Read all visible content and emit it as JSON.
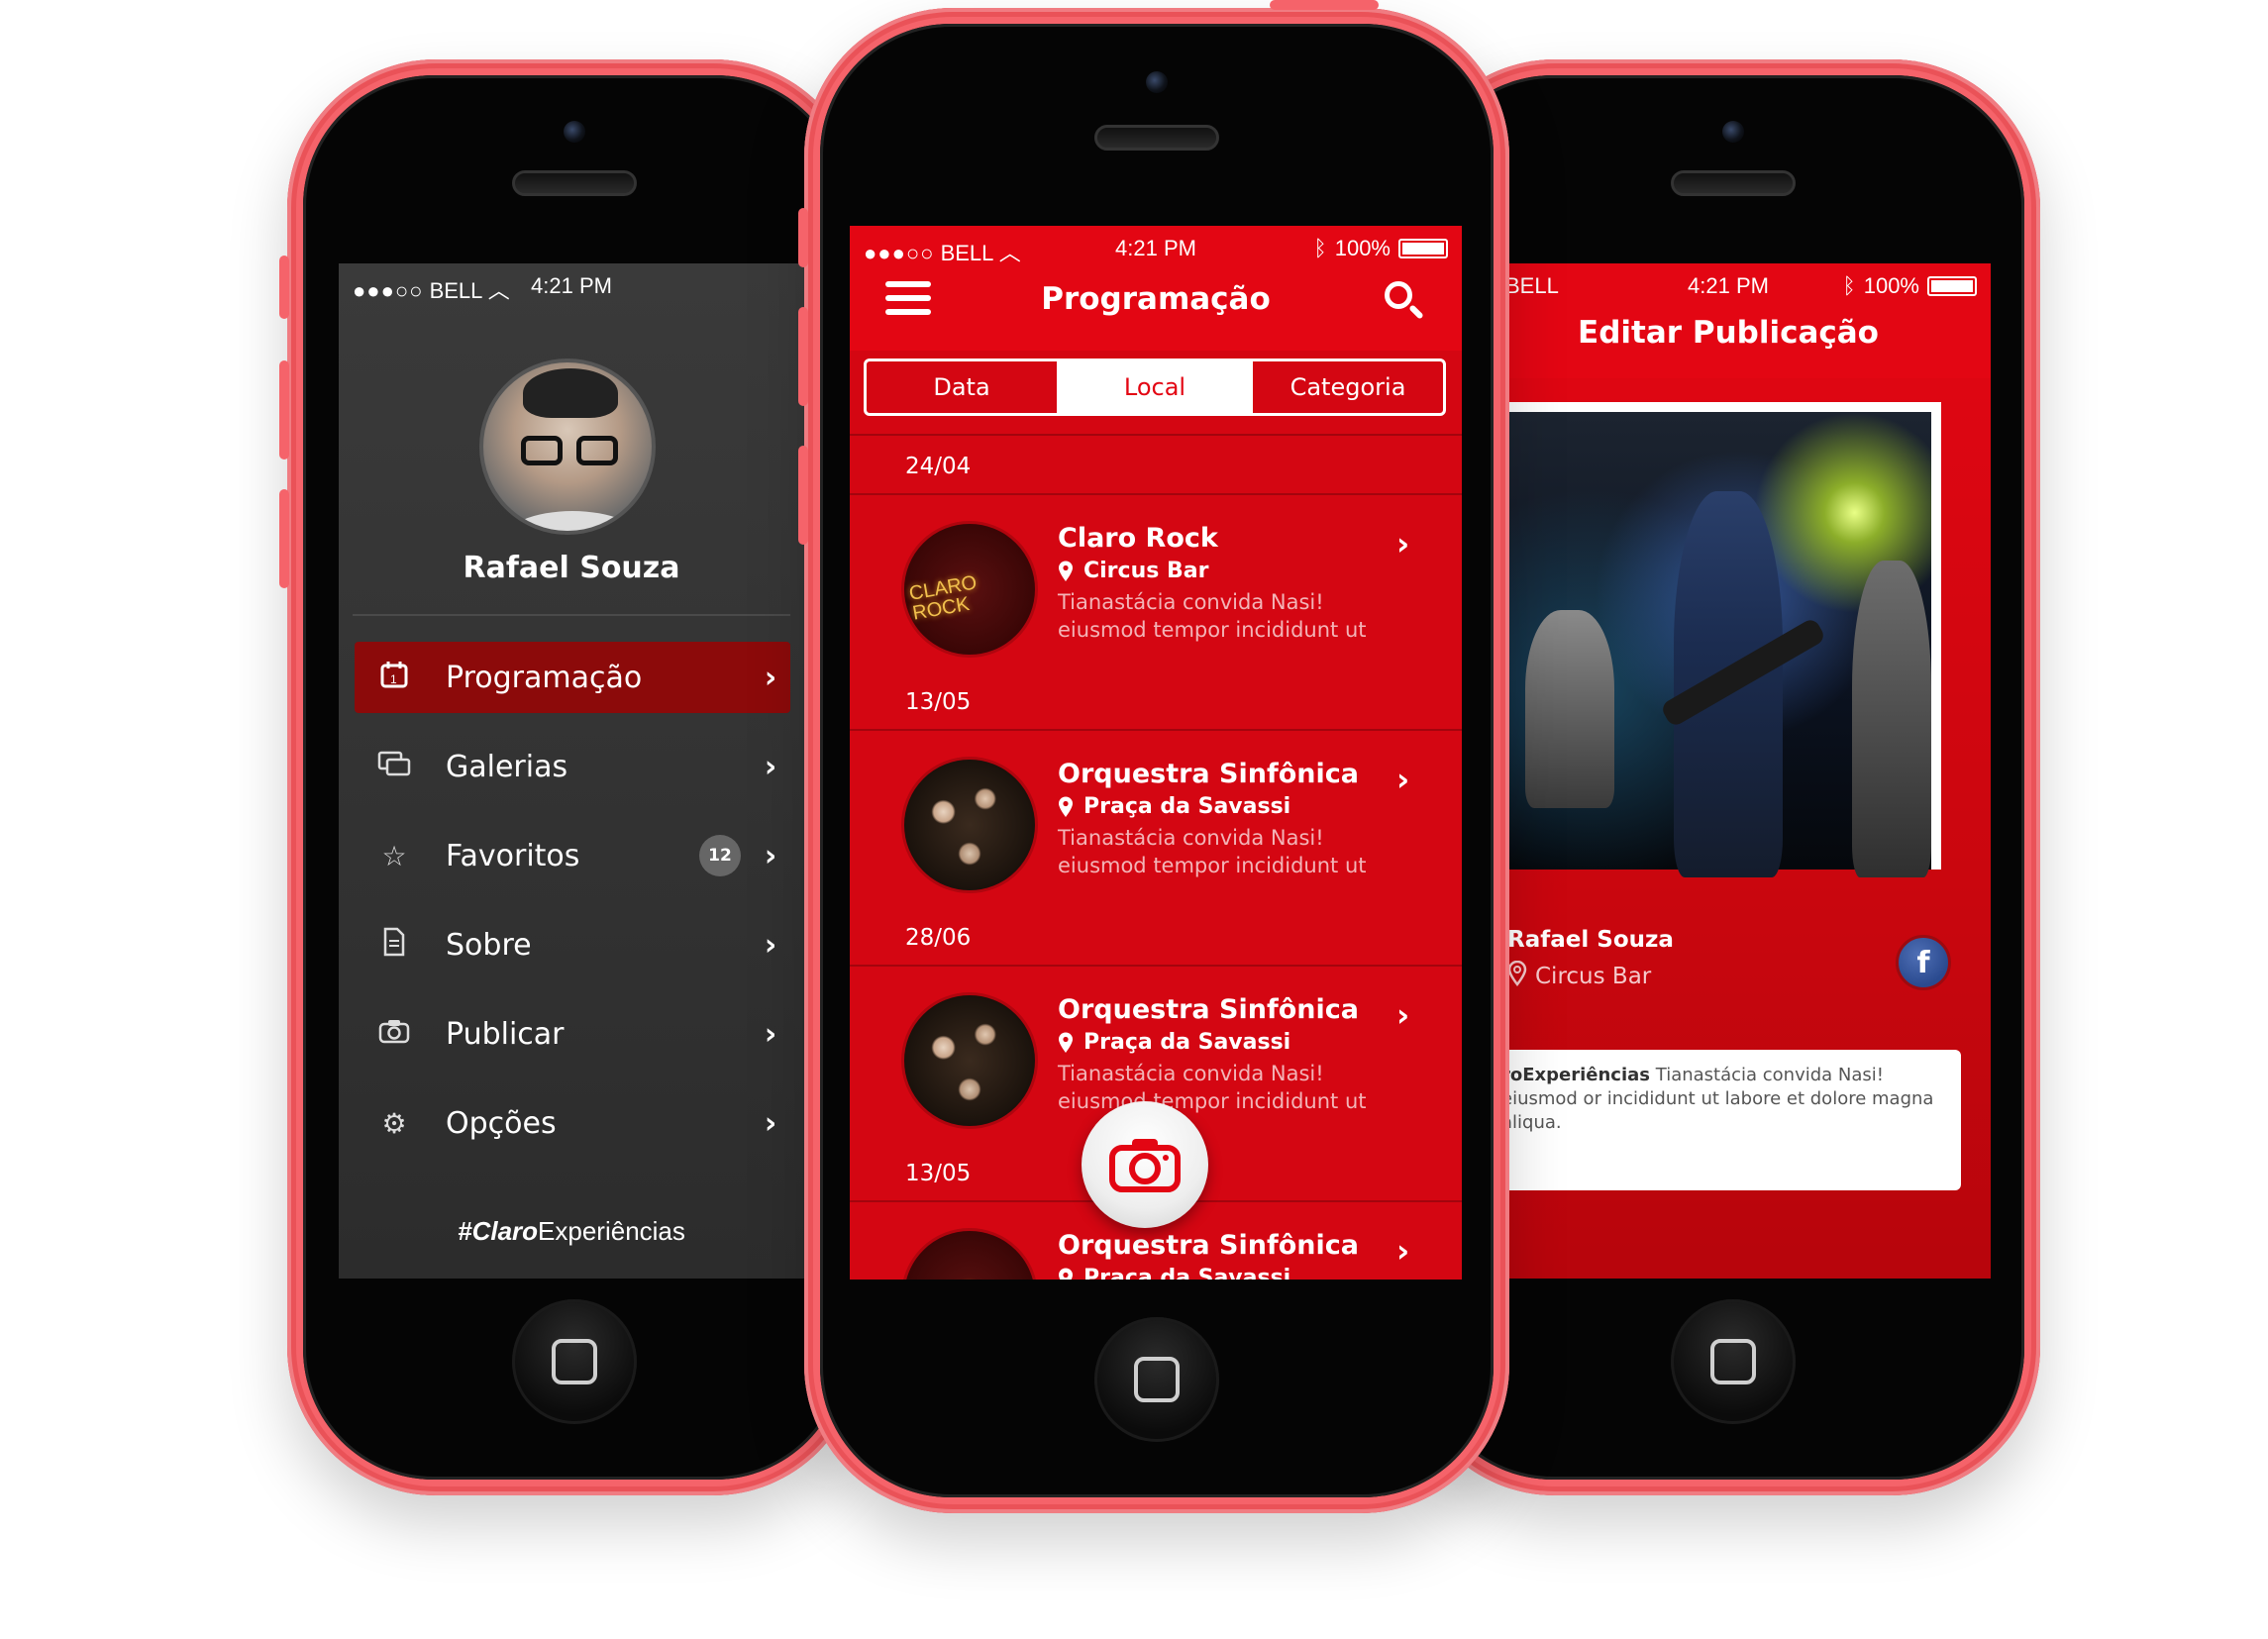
{
  "colors": {
    "brand_red": "#e30613",
    "dark_panel": "#333333",
    "phone_body": "#f5636a"
  },
  "status": {
    "carrier": "BELL",
    "time": "4:21 PM",
    "battery": "100%"
  },
  "left": {
    "user_name": "Rafael Souza",
    "menu": [
      {
        "label": "Programação",
        "icon": "calendar-icon",
        "active": true
      },
      {
        "label": "Galerias",
        "icon": "gallery-icon"
      },
      {
        "label": "Favoritos",
        "icon": "star-icon",
        "badge": "12"
      },
      {
        "label": "Sobre",
        "icon": "document-icon"
      },
      {
        "label": "Publicar",
        "icon": "camera-icon"
      },
      {
        "label": "Opções",
        "icon": "gear-icon"
      }
    ],
    "hashtag_prefix": "#",
    "hashtag_bold": "Claro",
    "hashtag_rest": "Experiências"
  },
  "center": {
    "title": "Programação",
    "tabs": [
      "Data",
      "Local",
      "Categoria"
    ],
    "active_tab": "Local",
    "sections": [
      {
        "date": "24/04",
        "title": "Claro Rock",
        "place": "Circus Bar",
        "desc": "Tianastácia convida Nasi! eiusmod tempor incididunt ut",
        "thumb": "rock"
      },
      {
        "date": "13/05",
        "title": "Orquestra Sinfônica",
        "place": "Praça da Savassi",
        "desc": "Tianastácia convida Nasi! eiusmod tempor incididunt ut",
        "thumb": "orch"
      },
      {
        "date": "28/06",
        "title": "Orquestra Sinfônica",
        "place": "Praça da Savassi",
        "desc": "Tianastácia convida Nasi! eiusmod tempor incididunt ut",
        "thumb": "orch"
      },
      {
        "date": "13/05",
        "title": "Orquestra Sinfônica",
        "place": "Praça da Savassi",
        "desc": "",
        "thumb": "rock"
      }
    ],
    "thumb_rock_text": "CLARO ROCK"
  },
  "right": {
    "title": "Editar Publicação",
    "author": "Rafael Souza",
    "place": "Circus Bar",
    "caption_bold": "roExperiências",
    "caption_text": "Tianastácia convida Nasi! eiusmod or incididunt ut labore et dolore magna aliqua."
  }
}
